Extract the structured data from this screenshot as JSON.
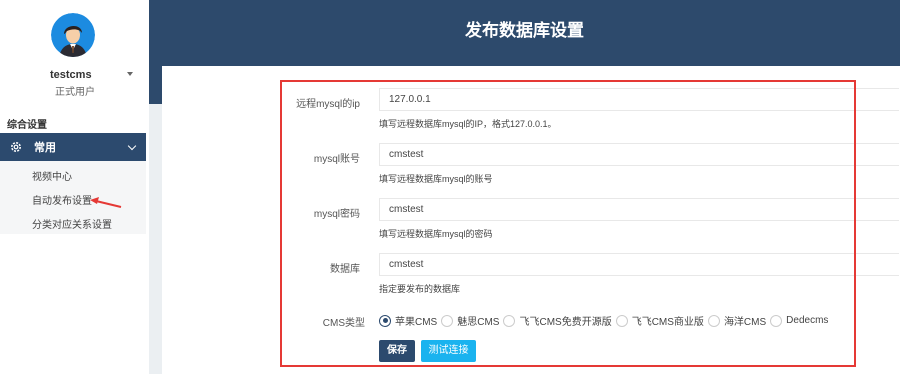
{
  "sidebar": {
    "username": "testcms",
    "role": "正式用户",
    "section_title": "综合设置",
    "menu_parent": "常用",
    "items": [
      "视频中心",
      "自动发布设置",
      "分类对应关系设置"
    ]
  },
  "header": {
    "title": "发布数据库设置"
  },
  "form": {
    "ip": {
      "label": "远程mysql的ip",
      "value": "127.0.0.1",
      "help": "填写远程数据库mysql的IP，格式127.0.0.1。"
    },
    "account": {
      "label": "mysql账号",
      "value": "cmstest",
      "help": "填写远程数据库mysql的账号"
    },
    "password": {
      "label": "mysql密码",
      "value": "cmstest",
      "help": "填写远程数据库mysql的密码"
    },
    "database": {
      "label": "数据库",
      "value": "cmstest",
      "help": "指定要发布的数据库"
    },
    "cms_type": {
      "label": "CMS类型",
      "options": [
        "苹果CMS",
        "魅思CMS",
        "飞飞CMS免费开源版",
        "飞飞CMS商业版",
        "海洋CMS",
        "Dedecms"
      ],
      "selected": "苹果CMS"
    },
    "save_label": "保存",
    "test_label": "测试连接"
  },
  "colors": {
    "accent": "#2c4a6e",
    "header": "#2d4a6c",
    "button_test": "#1ab3ef",
    "highlight": "#e53935"
  },
  "icons": {
    "menu": "gear-icon",
    "avatar": "avatar-icon",
    "arrow": "red-arrow-annotation"
  }
}
